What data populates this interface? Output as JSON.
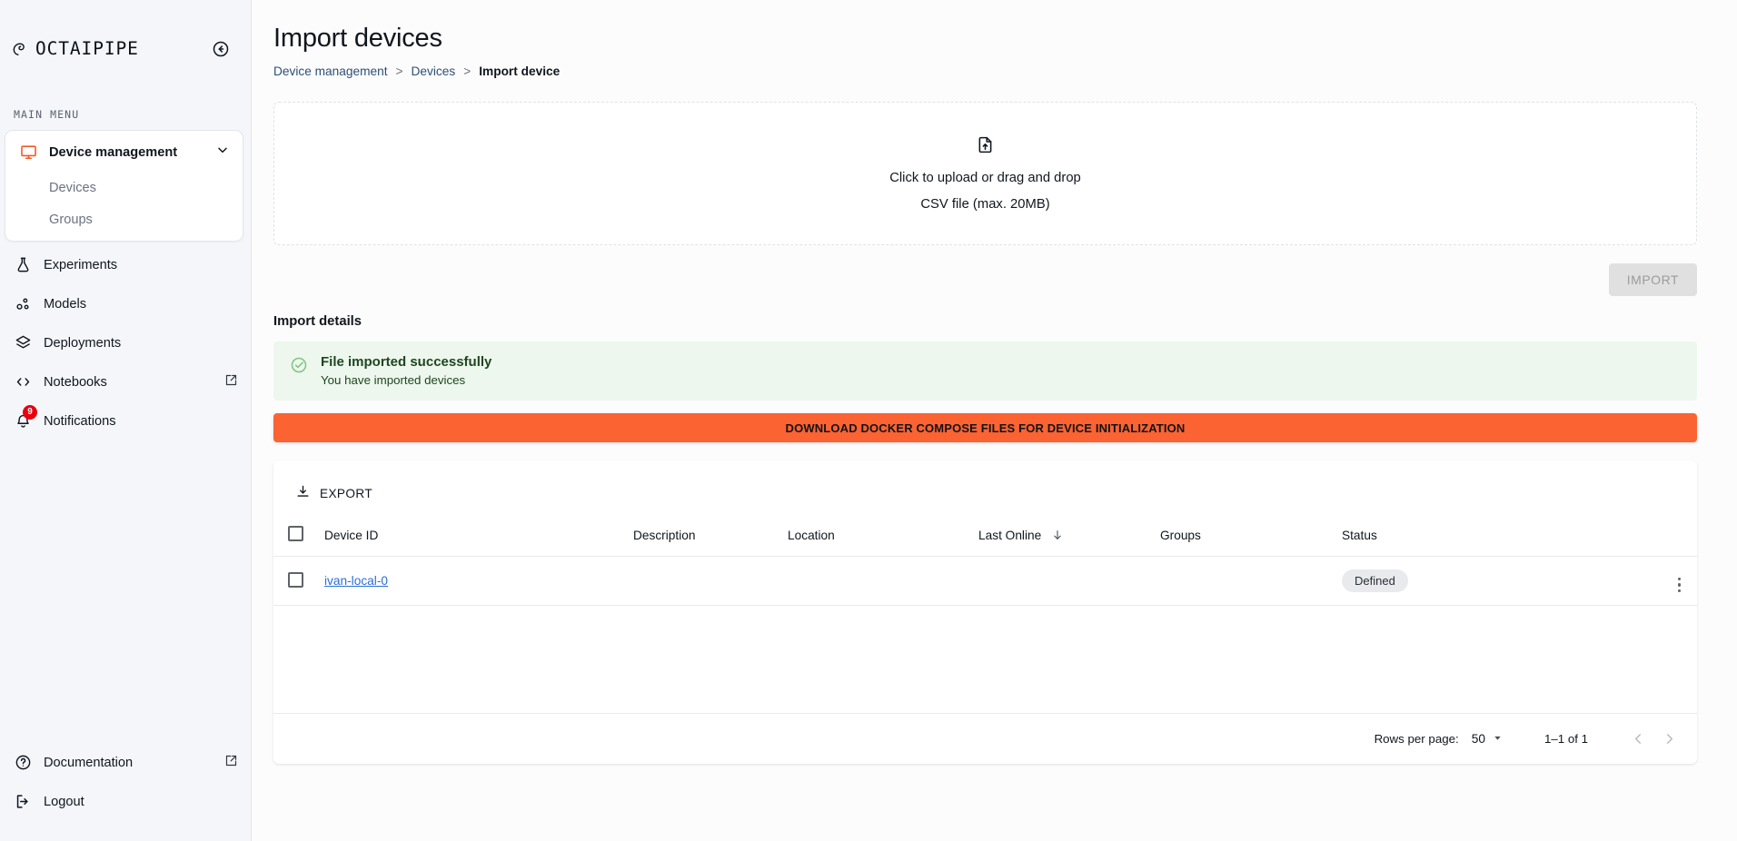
{
  "brand": {
    "name": "OCTAIPIPE",
    "collapse_icon": "circle-arrow-left-icon"
  },
  "sidebar": {
    "menu_label": "MAIN MENU",
    "group": {
      "parent": {
        "label": "Device management",
        "icon": "monitor-icon",
        "chevron": "chevron-down-icon"
      },
      "children": [
        {
          "label": "Devices"
        },
        {
          "label": "Groups"
        }
      ]
    },
    "items": [
      {
        "label": "Experiments",
        "icon": "flask-icon"
      },
      {
        "label": "Models",
        "icon": "models-nodes-icon"
      },
      {
        "label": "Deployments",
        "icon": "layers-icon"
      },
      {
        "label": "Notebooks",
        "icon": "code-brackets-icon",
        "external": true
      },
      {
        "label": "Notifications",
        "icon": "bell-icon",
        "badge": "9"
      }
    ],
    "bottom": [
      {
        "label": "Documentation",
        "icon": "help-circle-icon",
        "external": true
      },
      {
        "label": "Logout",
        "icon": "logout-icon"
      }
    ]
  },
  "header": {
    "title": "Import devices",
    "breadcrumb": [
      {
        "label": "Device management",
        "current": false
      },
      {
        "label": "Devices",
        "current": false
      },
      {
        "label": "Import device",
        "current": true
      }
    ],
    "separator": ">"
  },
  "dropzone": {
    "icon": "file-upload-icon",
    "line1": "Click to upload or drag and drop",
    "line2": "CSV file (max. 20MB)"
  },
  "import_button": {
    "label": "IMPORT",
    "disabled": true
  },
  "import_details": {
    "section_title": "Import details",
    "alert": {
      "icon": "check-circle-icon",
      "title": "File imported successfully",
      "subtitle": "You have imported devices"
    },
    "download_button": {
      "label": "DOWNLOAD DOCKER COMPOSE FILES FOR DEVICE INITIALIZATION"
    }
  },
  "table": {
    "export_label": "EXPORT",
    "export_icon": "download-icon",
    "columns": [
      {
        "key": "checkbox",
        "label": ""
      },
      {
        "key": "device_id",
        "label": "Device ID"
      },
      {
        "key": "description",
        "label": "Description"
      },
      {
        "key": "location",
        "label": "Location"
      },
      {
        "key": "last_online",
        "label": "Last Online",
        "sorted": "desc",
        "sort_icon": "arrow-down-icon"
      },
      {
        "key": "groups",
        "label": "Groups"
      },
      {
        "key": "status",
        "label": "Status"
      }
    ],
    "rows": [
      {
        "device_id": "ivan-local-0",
        "description": "",
        "location": "",
        "last_online": "",
        "groups": "",
        "status": "Defined",
        "menu_icon": "kebab-menu-icon"
      }
    ],
    "footer": {
      "rows_per_page_label": "Rows per page:",
      "rows_per_page_value": "50",
      "range": "1–1 of 1",
      "prev_icon": "chevron-left-icon",
      "next_icon": "chevron-right-icon"
    }
  },
  "colors": {
    "accent_orange": "#fb6333",
    "brand_orange": "#f05a28",
    "link_blue": "#2a6fd6",
    "breadcrumb_blue": "#2e4f75",
    "success_bg": "#edf7ed",
    "success_green": "#7fc47f",
    "badge_red": "#e8000d",
    "sidebar_bg": "#f4f6fa",
    "page_bg": "#fcfcfd"
  }
}
